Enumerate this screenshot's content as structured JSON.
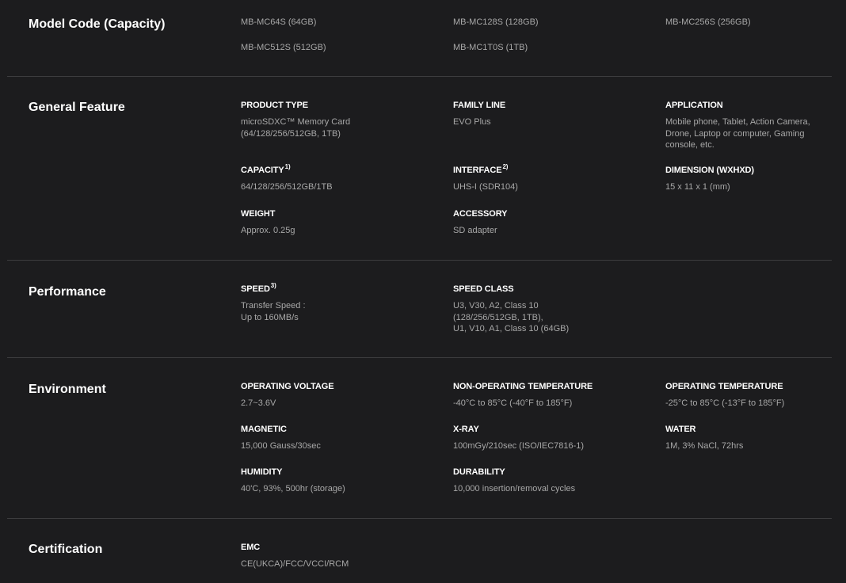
{
  "sections": {
    "model_code": {
      "title": "Model Code (Capacity)",
      "models": [
        "MB-MC64S (64GB)",
        "MB-MC128S (128GB)",
        "MB-MC256S (256GB)",
        "MB-MC512S (512GB)",
        "MB-MC1T0S (1TB)"
      ]
    },
    "general_feature": {
      "title": "General Feature",
      "product_type": {
        "label": "PRODUCT TYPE",
        "value": "microSDXC™ Memory Card\n(64/128/256/512GB, 1TB)"
      },
      "family_line": {
        "label": "FAMILY LINE",
        "value": "EVO Plus"
      },
      "application": {
        "label": "APPLICATION",
        "value": "Mobile phone, Tablet, Action Camera,\nDrone, Laptop or computer, Gaming\nconsole, etc."
      },
      "capacity": {
        "label": "CAPACITY",
        "sup": "1)",
        "value": "64/128/256/512GB/1TB"
      },
      "interface": {
        "label": "INTERFACE",
        "sup": "2)",
        "value": "UHS-I (SDR104)"
      },
      "dimension": {
        "label": "DIMENSION (WXHXD)",
        "value": "15 x 11 x 1 (mm)"
      },
      "weight": {
        "label": "WEIGHT",
        "value": "Approx. 0.25g"
      },
      "accessory": {
        "label": "ACCESSORY",
        "value": "SD adapter"
      }
    },
    "performance": {
      "title": "Performance",
      "speed": {
        "label": "SPEED",
        "sup": "3)",
        "value": "Transfer Speed :\nUp to 160MB/s"
      },
      "speed_class": {
        "label": "SPEED CLASS",
        "value": "U3, V30, A2, Class 10\n(128/256/512GB, 1TB),\nU1, V10, A1, Class 10 (64GB)"
      }
    },
    "environment": {
      "title": "Environment",
      "operating_voltage": {
        "label": "OPERATING VOLTAGE",
        "value": "2.7~3.6V"
      },
      "non_operating_temperature": {
        "label": "NON-OPERATING TEMPERATURE",
        "value": "-40°C to 85°C (-40°F to 185°F)"
      },
      "operating_temperature": {
        "label": "OPERATING TEMPERATURE",
        "value": "-25°C to 85°C (-13°F to 185°F)"
      },
      "magnetic": {
        "label": "MAGNETIC",
        "value": "15,000 Gauss/30sec"
      },
      "x_ray": {
        "label": "X-RAY",
        "value": "100mGy/210sec (ISO/IEC7816-1)"
      },
      "water": {
        "label": "WATER",
        "value": "1M, 3% NaCl, 72hrs"
      },
      "humidity": {
        "label": "HUMIDITY",
        "value": "40'C, 93%, 500hr (storage)"
      },
      "durability": {
        "label": "DURABILITY",
        "value": "10,000 insertion/removal cycles"
      }
    },
    "certification": {
      "title": "Certification",
      "emc": {
        "label": "EMC",
        "value": "CE(UKCA)/FCC/VCCI/RCM"
      }
    }
  }
}
